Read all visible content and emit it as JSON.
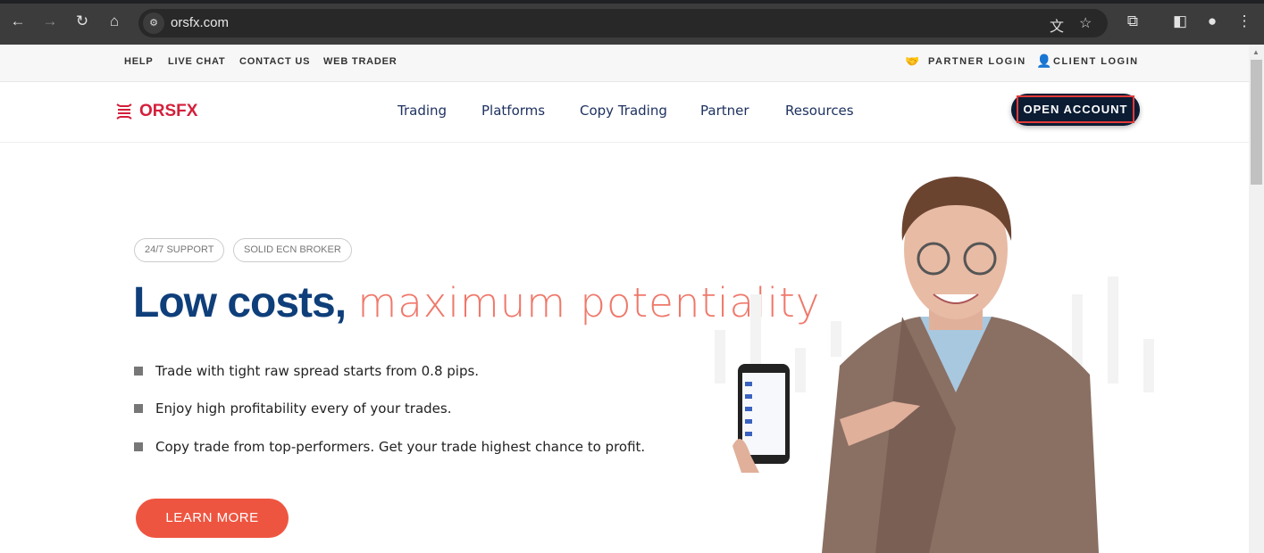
{
  "browser": {
    "url": "orsfx.com"
  },
  "topbar": {
    "links": [
      "HELP",
      "LIVE CHAT",
      "CONTACT US",
      "WEB TRADER"
    ],
    "partner_login": "PARTNER LOGIN",
    "client_login": "CLIENT LOGIN"
  },
  "nav": {
    "logo": "ORSFX",
    "items": [
      "Trading",
      "Platforms",
      "Copy Trading",
      "Partner",
      "Resources"
    ],
    "cta": "OPEN ACCOUNT"
  },
  "hero": {
    "badges": [
      "24/7 SUPPORT",
      "SOLID ECN BROKER"
    ],
    "title_bold": "Low costs,",
    "title_light": "maximum potentiality",
    "bullets": [
      "Trade with tight raw spread starts from 0.8 pips.",
      "Enjoy high profitability every of your trades.",
      "Copy trade from top-performers. Get your trade highest chance to profit."
    ],
    "button": "LEARN MORE"
  },
  "colors": {
    "brand": "#d41f3a",
    "navy": "#0b1c33",
    "title": "#0f3f7a",
    "accent": "#ee5540"
  }
}
